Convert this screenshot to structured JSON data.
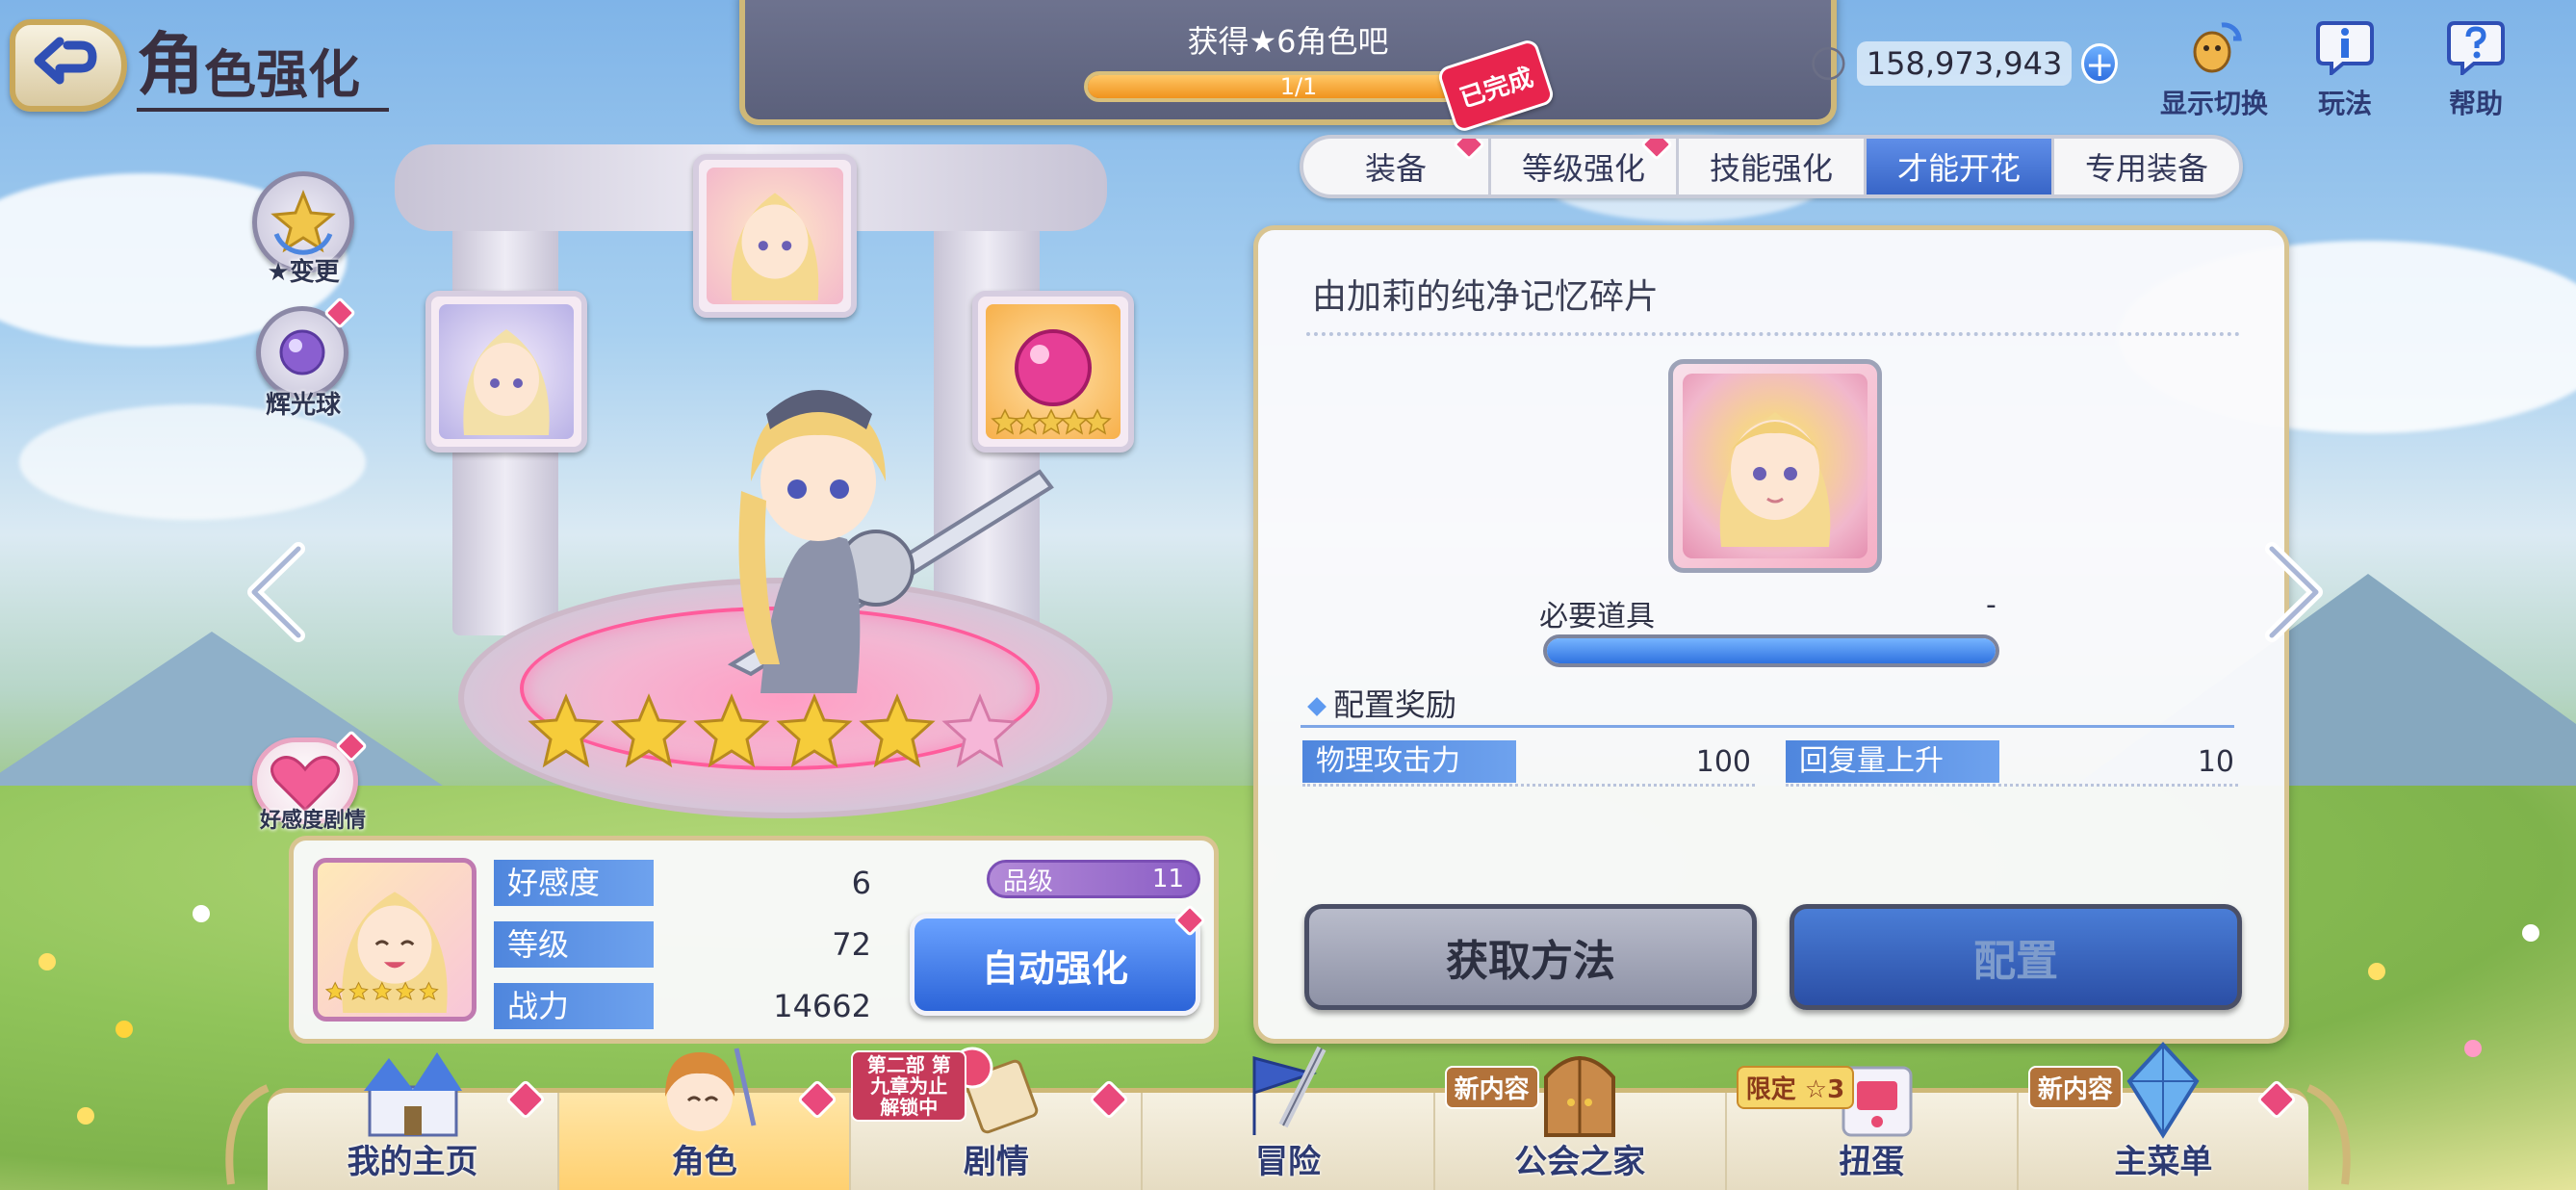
{
  "header": {
    "title_first": "角",
    "title_rest": "色强化"
  },
  "mission": {
    "text": "获得★6角色吧",
    "progress": "1/1",
    "progress_fraction": 1.0,
    "stamp": "已完成"
  },
  "currency": {
    "amount": "158,973,943",
    "plus": "+"
  },
  "top_icons": [
    {
      "label": "显示切换",
      "icon": "display-switch-icon"
    },
    {
      "label": "玩法",
      "icon": "info-icon"
    },
    {
      "label": "帮助",
      "icon": "help-icon"
    }
  ],
  "tabs": [
    {
      "label": "装备",
      "badge": true
    },
    {
      "label": "等级强化",
      "badge": true
    },
    {
      "label": "技能强化",
      "badge": false
    },
    {
      "label": "才能开花",
      "badge": false,
      "active": true
    },
    {
      "label": "专用装备",
      "badge": false
    }
  ],
  "left_side": {
    "star_change": "★变更",
    "glow_orb": "辉光球",
    "affection_story": "好感度剧情"
  },
  "hero": {
    "stars_gold": 5,
    "stars_pink": 1
  },
  "panel": {
    "item_name": "由加莉的纯净记忆碎片",
    "required_label": "必要道具",
    "required_value": "-",
    "required_fraction": 1.0,
    "reward_heading": "配置奖励",
    "stats": [
      {
        "label": "物理攻击力",
        "value": "100"
      },
      {
        "label": "回复量上升",
        "value": "10"
      }
    ],
    "btn_obtain": "获取方法",
    "btn_configure": "配置"
  },
  "info": {
    "rows": [
      {
        "label": "好感度",
        "value": "6"
      },
      {
        "label": "等级",
        "value": "72"
      },
      {
        "label": "战力",
        "value": "14662"
      }
    ],
    "grade_label": "品级",
    "grade_value": "11",
    "auto_button": "自动强化",
    "thumb_stars": 5
  },
  "bottom_nav": [
    {
      "label": "我的主页",
      "icon": "castle-icon",
      "badge": true
    },
    {
      "label": "角色",
      "icon": "character-icon",
      "badge": true,
      "active": true
    },
    {
      "label": "剧情",
      "icon": "scroll-icon",
      "badge": true,
      "tag": "第二部 第九章为止 解锁中"
    },
    {
      "label": "冒险",
      "icon": "flag-sword-icon",
      "badge": false
    },
    {
      "label": "公会之家",
      "icon": "guild-door-icon",
      "badge": false,
      "tag": "新内容"
    },
    {
      "label": "扭蛋",
      "icon": "gacha-icon",
      "badge": false,
      "tag": "限定 ☆3"
    },
    {
      "label": "主菜单",
      "icon": "crystal-menu-icon",
      "badge": true,
      "tag": "新内容"
    }
  ],
  "colors": {
    "accent_blue": "#3865c7",
    "gold_frame": "#d8c491",
    "badge_pink": "#e9497c",
    "stamp_red": "#e8244d"
  }
}
